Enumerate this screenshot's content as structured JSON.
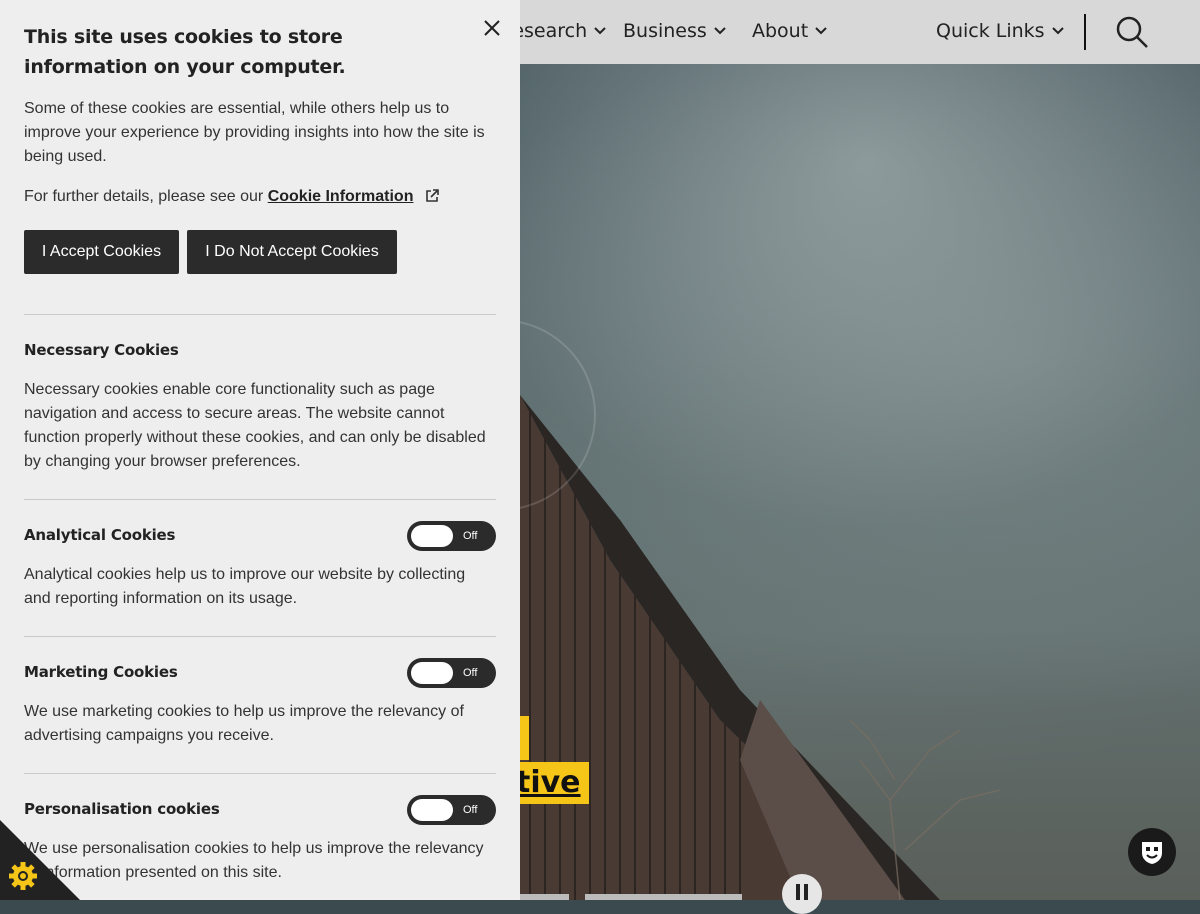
{
  "nav": {
    "items": [
      {
        "label": "Research"
      },
      {
        "label": "Business"
      },
      {
        "label": "About"
      }
    ],
    "quick_links": "Quick Links",
    "search_icon": "search-icon"
  },
  "hero": {
    "headline_fragment": "tive"
  },
  "cookie_banner": {
    "title": "This site uses cookies to store information on your computer.",
    "intro": "Some of these cookies are essential, while others help us to improve your experience by providing insights into how the site is being used.",
    "details_prefix": "For further details, please see our",
    "details_link": "Cookie Information",
    "accept_label": "I Accept Cookies",
    "reject_label": "I Do Not Accept Cookies",
    "sections": [
      {
        "title": "Necessary Cookies",
        "text": "Necessary cookies enable core functionality such as page navigation and access to secure areas. The website cannot function properly without these cookies, and can only be disabled by changing your browser preferences."
      },
      {
        "title": "Analytical Cookies",
        "text": "Analytical cookies help us to improve our website by collecting and reporting information on its usage.",
        "toggle": "Off"
      },
      {
        "title": "Marketing Cookies",
        "text": "We use marketing cookies to help us improve the relevancy of advertising campaigns you receive.",
        "toggle": "Off"
      },
      {
        "title": "Personalisation cookies",
        "text": "We use personalisation cookies to help us improve the relevancy of information presented on this site.",
        "toggle": "Off"
      }
    ]
  },
  "colors": {
    "accent": "#f5c518",
    "button_bg": "#2b2b2b",
    "panel_bg": "#eeeeee"
  }
}
